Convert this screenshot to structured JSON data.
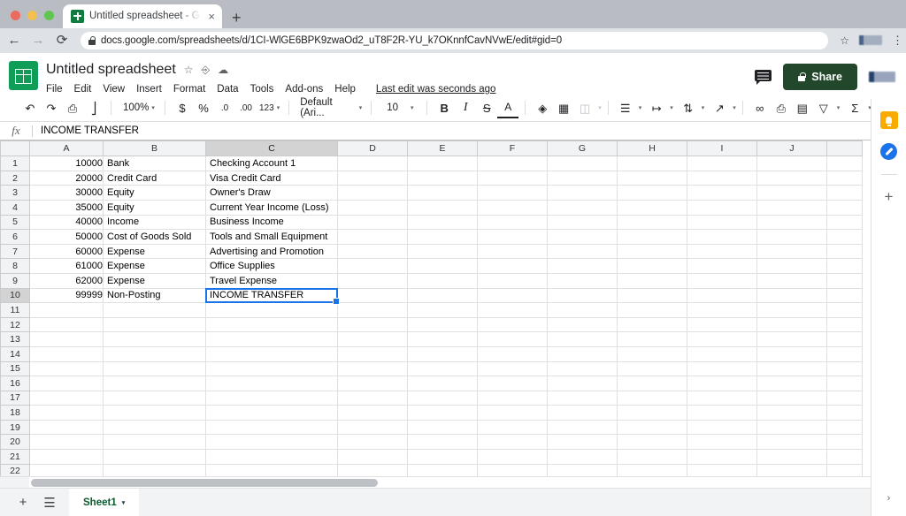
{
  "browser": {
    "traffic_lights": [
      "close",
      "minimize",
      "zoom"
    ],
    "tab": {
      "title": "Untitled spreadsheet - Google",
      "favicon": "sheets-icon",
      "close_label": "×"
    },
    "new_tab_label": "+",
    "nav": {
      "back": "←",
      "forward": "→",
      "reload": "⟳"
    },
    "url": "docs.google.com/spreadsheets/d/1CI-WlGE6BPK9zwaOd2_uT8F2R-YU_k7OKnnfCavNVwE/edit#gid=0",
    "star_label": "☆",
    "menu_label": "⋮"
  },
  "sheets": {
    "doc_title": "Untitled spreadsheet",
    "title_icons": [
      "star-icon",
      "move-to-folder-icon",
      "cloud-saved-icon"
    ],
    "menu": [
      "File",
      "Edit",
      "View",
      "Insert",
      "Format",
      "Data",
      "Tools",
      "Add-ons",
      "Help"
    ],
    "last_edit": "Last edit was seconds ago",
    "share_label": "Share",
    "comment_icon": "comment-icon",
    "avatar": "user-avatar"
  },
  "toolbar": {
    "undo": "↶",
    "redo": "↷",
    "print": "⎙",
    "paint_format": "paint-format-icon",
    "zoom_value": "100%",
    "currency": "$",
    "percent": "%",
    "decrease_decimal": ".0",
    "increase_decimal": ".00",
    "number_format": "123",
    "font_value": "Default (Ari...",
    "font_size": "10",
    "bold": "B",
    "italic": "I",
    "strikethrough": "S",
    "text_color": "A",
    "fill_color": "fill-color-icon",
    "borders": "borders-icon",
    "merge_cells": "merge-cells-icon",
    "horizontal_align": "align-icon",
    "vertical_align": "vertical-align-icon",
    "text_wrap": "text-wrap-icon",
    "text_rotation": "text-rotation-icon",
    "insert_link": "🔗",
    "insert_comment": "insert-comment-icon",
    "insert_chart": "insert-chart-icon",
    "filter": "▽",
    "functions": "Σ",
    "collapse": "˄",
    "caret": "▾"
  },
  "formula_bar": {
    "fx_label": "fx",
    "value": "INCOME TRANSFER"
  },
  "grid": {
    "columns": [
      "A",
      "B",
      "C",
      "D",
      "E",
      "F",
      "G",
      "H",
      "I",
      "J"
    ],
    "selected_column": "C",
    "selected_row": 10,
    "selected_cell": "C10",
    "row_count": 22,
    "rows": [
      {
        "n": 1,
        "a": "10000",
        "b": "Bank",
        "c": "Checking Account 1"
      },
      {
        "n": 2,
        "a": "20000",
        "b": "Credit Card",
        "c": "Visa Credit Card"
      },
      {
        "n": 3,
        "a": "30000",
        "b": "Equity",
        "c": "Owner's Draw"
      },
      {
        "n": 4,
        "a": "35000",
        "b": "Equity",
        "c": "Current Year Income (Loss)"
      },
      {
        "n": 5,
        "a": "40000",
        "b": "Income",
        "c": "Business Income"
      },
      {
        "n": 6,
        "a": "50000",
        "b": "Cost of Goods Sold",
        "c": "Tools and Small Equipment"
      },
      {
        "n": 7,
        "a": "60000",
        "b": "Expense",
        "c": "Advertising and Promotion"
      },
      {
        "n": 8,
        "a": "61000",
        "b": "Expense",
        "c": "Office Supplies"
      },
      {
        "n": 9,
        "a": "62000",
        "b": "Expense",
        "c": "Travel Expense"
      },
      {
        "n": 10,
        "a": "99999",
        "b": "Non-Posting",
        "c": "INCOME TRANSFER"
      },
      {
        "n": 11,
        "a": "",
        "b": "",
        "c": ""
      },
      {
        "n": 12,
        "a": "",
        "b": "",
        "c": ""
      },
      {
        "n": 13,
        "a": "",
        "b": "",
        "c": ""
      },
      {
        "n": 14,
        "a": "",
        "b": "",
        "c": ""
      },
      {
        "n": 15,
        "a": "",
        "b": "",
        "c": ""
      },
      {
        "n": 16,
        "a": "",
        "b": "",
        "c": ""
      },
      {
        "n": 17,
        "a": "",
        "b": "",
        "c": ""
      },
      {
        "n": 18,
        "a": "",
        "b": "",
        "c": ""
      },
      {
        "n": 19,
        "a": "",
        "b": "",
        "c": ""
      },
      {
        "n": 20,
        "a": "",
        "b": "",
        "c": ""
      },
      {
        "n": 21,
        "a": "",
        "b": "",
        "c": ""
      },
      {
        "n": 22,
        "a": "",
        "b": "",
        "c": ""
      }
    ]
  },
  "bottom": {
    "add_sheet": "+",
    "all_sheets": "☰",
    "sheet_name": "Sheet1",
    "sheet_caret": "▾"
  },
  "side_panel": {
    "keep": "keep-icon",
    "tasks": "tasks-icon",
    "add": "+",
    "expand": "›"
  },
  "colors": {
    "sheets_green": "#0f9d58",
    "share_green": "#23472b",
    "selection_blue": "#1a73e8",
    "keep_orange": "#f9ab00",
    "tasks_blue": "#1a73e8"
  }
}
